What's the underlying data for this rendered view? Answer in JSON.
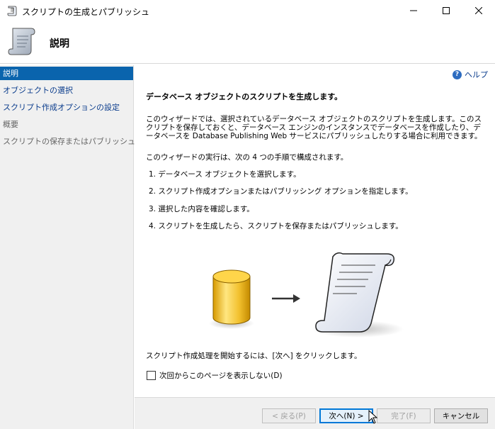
{
  "window": {
    "title": "スクリプトの生成とパブリッシュ",
    "minimize": "—",
    "maximize": "☐",
    "close": "✕"
  },
  "header": {
    "title": "説明",
    "icon": "scroll-icon"
  },
  "sidebar": {
    "items": [
      {
        "label": "説明",
        "state": "active"
      },
      {
        "label": "オブジェクトの選択",
        "state": "link"
      },
      {
        "label": "スクリプト作成オプションの設定",
        "state": "link"
      },
      {
        "label": "概要",
        "state": "disabled"
      },
      {
        "label": "スクリプトの保存またはパブリッシュ",
        "state": "disabled"
      }
    ]
  },
  "content": {
    "help_label": "ヘルプ",
    "heading": "データベース オブジェクトのスクリプトを生成します。",
    "description": "このウィザードでは、選択されているデータベース オブジェクトのスクリプトを生成します。このスクリプトを保存しておくと、データベース エンジンのインスタンスでデータベースを作成したり、データベースを Database Publishing Web サービスにパブリッシュしたりする場合に利用できます。",
    "steps_intro": "このウィザードの実行は、次の 4 つの手順で構成されます。",
    "steps": [
      "1. データベース オブジェクトを選択します。",
      "2. スクリプト作成オプションまたはパブリッシング オプションを指定します。",
      "3. 選択した内容を確認します。",
      "4. スクリプトを生成したら、スクリプトを保存またはパブリッシュします。"
    ],
    "start_hint": "スクリプト作成処理を開始するには、[次へ] をクリックします。",
    "dont_show_label": "次回からこのページを表示しない(D)",
    "dont_show_checked": false
  },
  "footer": {
    "back": "< 戻る(P)",
    "next": "次へ(N) >",
    "finish": "完了(F)",
    "cancel": "キャンセル"
  },
  "colors": {
    "accent": "#0a64ad",
    "link": "#0a3c8c",
    "database": "#f2c12e"
  }
}
